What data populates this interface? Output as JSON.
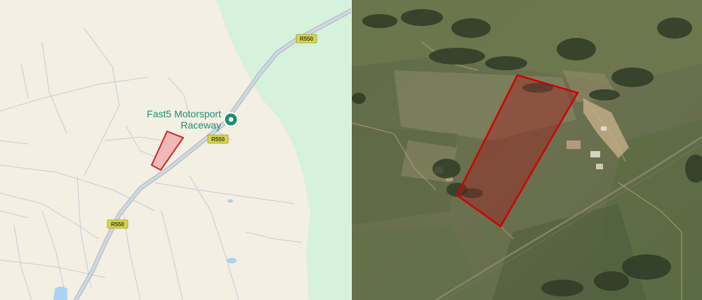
{
  "map_view": {
    "poi": {
      "name_line1": "Fast5 Motorsport",
      "name_line2": "Raceway",
      "icon": "place-pin-icon",
      "color": "#1e8f6e"
    },
    "road_shields": [
      "R550",
      "R550",
      "R550"
    ],
    "colors": {
      "land": "#f4efe3",
      "green_area": "#d6f1dc",
      "road": "#c9cfd8",
      "road_edge": "#a9b3c0",
      "water": "#aad3f2",
      "shield_fill": "#d7d64a",
      "parcel_fill": "#f3b9b6",
      "parcel_stroke": "#c62828"
    }
  },
  "satellite_view": {
    "parcel_stroke": "#d00000",
    "parcel_fill": "rgba(160,30,30,0.45)"
  }
}
